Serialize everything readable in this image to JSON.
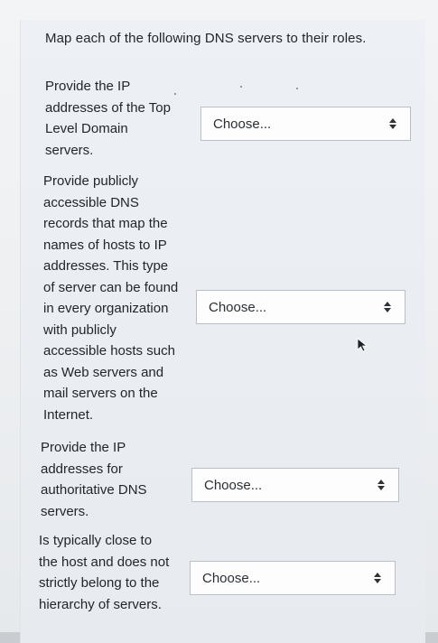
{
  "question": {
    "instruction": "Map each of the following DNS servers to their roles."
  },
  "items": [
    {
      "lines": [
        "Provide the IP",
        "addresses of the Top",
        "Level Domain",
        "servers."
      ],
      "select_value": "Choose..."
    },
    {
      "lines": [
        "Provide publicly",
        "accessible DNS",
        "records that map the",
        "names of hosts to IP",
        "addresses. This type",
        "of server can be found",
        "in every organization",
        "with publicly",
        "accessible hosts such",
        "as Web servers and",
        "mail servers on the",
        "Internet."
      ],
      "select_value": "Choose..."
    },
    {
      "lines": [
        "Provide the IP",
        "addresses for",
        "authoritative DNS",
        "servers."
      ],
      "select_value": "Choose..."
    },
    {
      "lines": [
        "Is typically close to",
        "the host and does not",
        "strictly belong to the",
        "hierarchy of servers."
      ],
      "select_value": "Choose..."
    }
  ],
  "icons": {
    "select_caret": "up-down-chevron-icon",
    "pointer": "mouse-pointer-icon"
  },
  "colors": {
    "background": "#eef0f2",
    "text": "#22262b",
    "select_border": "#b9bfc6",
    "select_fill": "#fdfdfe"
  }
}
